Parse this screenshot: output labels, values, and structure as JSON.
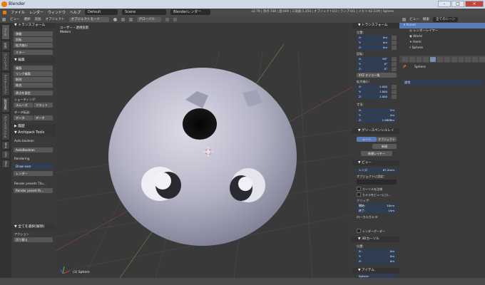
{
  "window": {
    "title": "Blender",
    "controls": {
      "minimize": "-",
      "maximize": "□",
      "close": "×"
    }
  },
  "menubar": {
    "items": [
      "ファイル",
      "レンダー",
      "ウィンドウ",
      "ヘルプ"
    ],
    "layout": "Default",
    "scene": "Scene",
    "engine": "Blenderレンダー",
    "stats": "v2.79 | 頂点:748 | 面:609 | 三角面:1,350 | オブジェクト0/2 | ランプ:0/1 | メモリ:42.51M | Sphere"
  },
  "viewport_header": {
    "items": [
      "ビュー",
      "選択",
      "追加",
      "オブジェクト"
    ],
    "mode": "オブジェクトモード",
    "orientation": "グローバル"
  },
  "tabs": [
    "ツール",
    "作成",
    "リレーション",
    "アニメーション",
    "物理演算",
    "グリースペンシル",
    "Mira",
    "UVs",
    "Misc"
  ],
  "toolshelf": {
    "transform": {
      "header": "トランスフォーム",
      "buttons": [
        "移動",
        "回転",
        "拡大縮小",
        "ミラー"
      ]
    },
    "edit": {
      "header": "編集",
      "buttons": [
        "複製",
        "リンク複製",
        "削除",
        "結合"
      ],
      "origin": "原点を設定",
      "shading_label": "シェーディング:",
      "smooth": "スムーズ",
      "flat": "フラット",
      "data_transfer_label": "データ転送:",
      "data": "データ",
      "data_layout": "データ"
    },
    "history": {
      "header": "履歴"
    },
    "archipack": {
      "header": "Archipack Tools",
      "autoboolean": "Auto boolean",
      "autoboolean_btn": "AutoBoolean",
      "rendering": "Rendering",
      "draw_over": "Draw over",
      "render": "レンダー",
      "presets_thumb": "Render presets Thu...",
      "presets_thumb2": "Render preset th..."
    },
    "operator": {
      "header": "全てを選択(解除)",
      "action_label": "アクション",
      "action": "切り替え"
    }
  },
  "viewport": {
    "view_name": "ユーザー・透視投影",
    "unit": "Meters",
    "object_label": "(1) Sphere"
  },
  "npanel": {
    "transform": {
      "header": "トランスフォーム",
      "location_label": "位置:",
      "location": [
        {
          "axis": "X:",
          "value": "0m"
        },
        {
          "axis": "Y:",
          "value": "0m"
        },
        {
          "axis": "Z:",
          "value": "0m"
        }
      ],
      "rotation_label": "回転:",
      "rotation": [
        {
          "axis": "X:",
          "value": "90°"
        },
        {
          "axis": "Y:",
          "value": "0°"
        },
        {
          "axis": "Z:",
          "value": "0°"
        }
      ],
      "euler": "XYZ オイラー角",
      "scale_label": "拡大縮小:",
      "scale": [
        {
          "axis": "X:",
          "value": "1.000"
        },
        {
          "axis": "Y:",
          "value": "1.000"
        },
        {
          "axis": "Z:",
          "value": "1.000"
        }
      ],
      "dimensions_label": "寸法:",
      "dimensions": [
        {
          "axis": "X:",
          "value": "2m"
        },
        {
          "axis": "Y:",
          "value": "2m"
        },
        {
          "axis": "Z:",
          "value": "1.9868m"
        }
      ]
    },
    "grease": {
      "header": "グリースペンシルレイ",
      "scene": "シーン",
      "object": "オブジェクト",
      "new": "新規",
      "new_layer": "新規レイヤー"
    },
    "view": {
      "header": "ビュー",
      "lens_label": "レンズ:",
      "lens": "67.2mm",
      "lock_label": "オブジェクトに固定:",
      "lock_cursor": "カーソルを注視",
      "lock_camera": "カメラをビューにロ...",
      "clip_label": "クリップ:",
      "clip_start_label": "開始:",
      "clip_start": "10cm",
      "clip_end_label": "終了:",
      "clip_end": "1km",
      "local_camera": "ローカルカメラ:",
      "render_border": "レンダーボーダー"
    },
    "cursor": {
      "header": "3Dカーソル",
      "location_label": "位置:",
      "location": [
        {
          "axis": "X:",
          "value": "0m"
        },
        {
          "axis": "Y:",
          "value": "0m"
        },
        {
          "axis": "Z:",
          "value": "0m"
        }
      ]
    },
    "item": {
      "header": "アイテム",
      "name": "Sphere"
    }
  },
  "outliner": {
    "header": [
      "ビュー",
      "検索",
      "全てのシーン"
    ],
    "items": [
      "Scene",
      "レンダーレイヤー",
      "World",
      "Hemi",
      "Sphere"
    ]
  },
  "properties": {
    "object": "Sphere",
    "field": "通常"
  },
  "colors": {
    "accent": "#5a7ab8",
    "field_blue": "#2f3e57",
    "sphere": "#b8b8c8"
  }
}
